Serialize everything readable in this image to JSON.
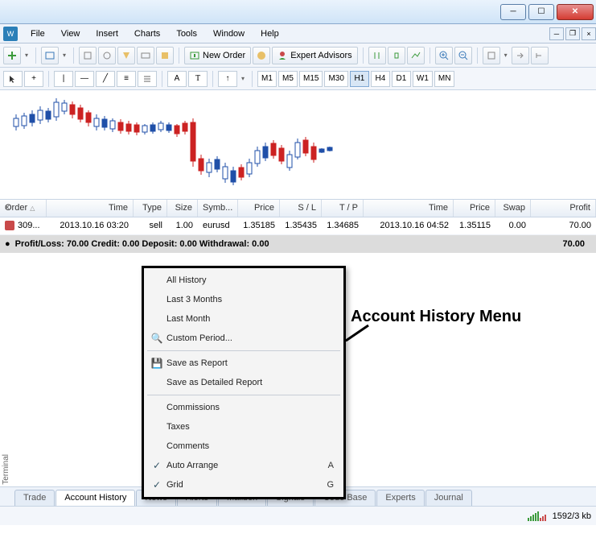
{
  "menubar": {
    "items": [
      "File",
      "View",
      "Insert",
      "Charts",
      "Tools",
      "Window",
      "Help"
    ]
  },
  "toolbar1": {
    "newOrder": "New Order",
    "expertAdvisors": "Expert Advisors"
  },
  "timeframes": [
    "M1",
    "M5",
    "M15",
    "M30",
    "H1",
    "H4",
    "D1",
    "W1",
    "MN"
  ],
  "activeTimeframe": "H1",
  "table": {
    "headers": {
      "order": "Order",
      "time": "Time",
      "type": "Type",
      "size": "Size",
      "symbol": "Symb...",
      "price": "Price",
      "sl": "S / L",
      "tp": "T / P",
      "time2": "Time",
      "price2": "Price",
      "swap": "Swap",
      "profit": "Profit"
    },
    "row": {
      "order": "309...",
      "time": "2013.10.16 03:20",
      "type": "sell",
      "size": "1.00",
      "symbol": "eurusd",
      "price": "1.35185",
      "sl": "1.35435",
      "tp": "1.34685",
      "time2": "2013.10.16 04:52",
      "price2": "1.35115",
      "swap": "0.00",
      "profit": "70.00"
    },
    "summary": {
      "text": "Profit/Loss: 70.00  Credit: 0.00  Deposit: 0.00  Withdrawal: 0.00",
      "right": "70.00"
    }
  },
  "contextMenu": {
    "allHistory": "All History",
    "last3Months": "Last 3 Months",
    "lastMonth": "Last Month",
    "customPeriod": "Custom Period...",
    "saveReport": "Save as Report",
    "saveDetailed": "Save as Detailed Report",
    "commissions": "Commissions",
    "taxes": "Taxes",
    "comments": "Comments",
    "autoArrange": "Auto Arrange",
    "autoArrangeShort": "A",
    "grid": "Grid",
    "gridShort": "G"
  },
  "annotation": "Account History Menu",
  "bottomTabs": [
    "Trade",
    "Account History",
    "News",
    "Alerts",
    "Mailbox",
    "Signals",
    "Code Base",
    "Experts",
    "Journal"
  ],
  "activeBottomTab": 1,
  "terminalLabel": "Terminal",
  "status": {
    "traffic": "1592/3 kb"
  }
}
